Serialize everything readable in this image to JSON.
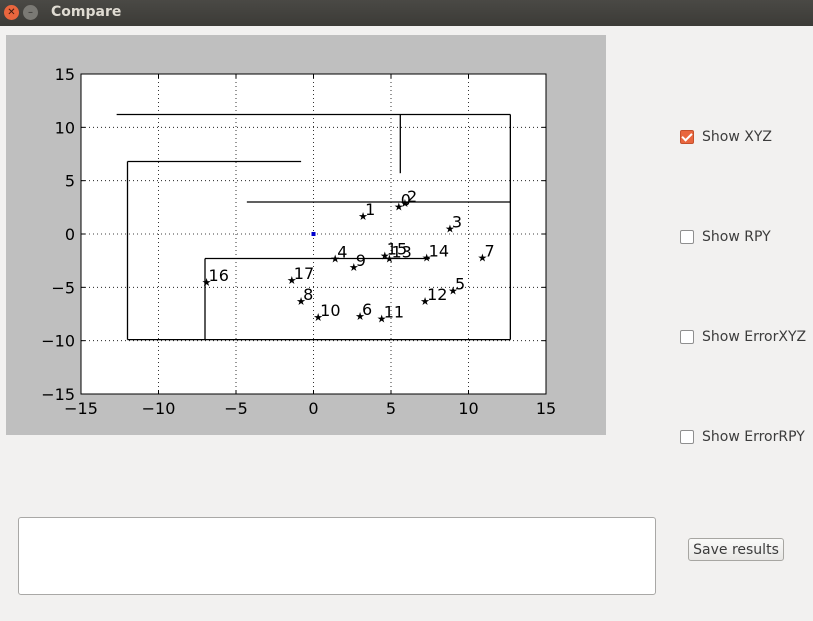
{
  "window": {
    "title": "Compare"
  },
  "options": [
    {
      "label": "Show XYZ",
      "checked": true
    },
    {
      "label": "Show RPY",
      "checked": false
    },
    {
      "label": "Show ErrorXYZ",
      "checked": false
    },
    {
      "label": "Show ErrorRPY",
      "checked": false
    }
  ],
  "results_text": "",
  "save_button": {
    "label": "Save results"
  },
  "chart_data": {
    "type": "scatter",
    "xlim": [
      -15,
      15
    ],
    "ylim": [
      -15,
      15
    ],
    "xticks": [
      -15,
      -10,
      -5,
      0,
      5,
      10,
      15
    ],
    "yticks": [
      -15,
      -10,
      -5,
      0,
      5,
      10,
      15
    ],
    "grid": "dotted",
    "points": [
      {
        "label": "0",
        "x": 5.5,
        "y": 2.6
      },
      {
        "label": "1",
        "x": 3.2,
        "y": 1.7
      },
      {
        "label": "2",
        "x": 5.9,
        "y": 2.9
      },
      {
        "label": "3",
        "x": 8.8,
        "y": 0.5
      },
      {
        "label": "4",
        "x": 1.4,
        "y": -2.3
      },
      {
        "label": "5",
        "x": 9.0,
        "y": -5.3
      },
      {
        "label": "6",
        "x": 3.0,
        "y": -7.7
      },
      {
        "label": "7",
        "x": 10.9,
        "y": -2.2
      },
      {
        "label": "8",
        "x": -0.8,
        "y": -6.3
      },
      {
        "label": "9",
        "x": 2.6,
        "y": -3.1
      },
      {
        "label": "10",
        "x": 0.3,
        "y": -7.8
      },
      {
        "label": "11",
        "x": 4.4,
        "y": -7.9
      },
      {
        "label": "12",
        "x": 7.2,
        "y": -6.3
      },
      {
        "label": "13",
        "x": 4.9,
        "y": -2.3
      },
      {
        "label": "14",
        "x": 7.3,
        "y": -2.2
      },
      {
        "label": "15",
        "x": 4.6,
        "y": -2.0
      },
      {
        "label": "16",
        "x": -6.9,
        "y": -4.5
      },
      {
        "label": "17",
        "x": -1.4,
        "y": -4.3
      }
    ],
    "marker_points": [
      {
        "x": 0,
        "y": 0,
        "color": "#0000cc"
      }
    ],
    "walls": [
      {
        "x": [
          -12.7,
          12.7
        ],
        "y": [
          11.2,
          11.2
        ]
      },
      {
        "x": [
          12.7,
          12.7
        ],
        "y": [
          11.2,
          -9.9
        ]
      },
      {
        "x": [
          -12.0,
          12.7
        ],
        "y": [
          -9.9,
          -9.9
        ]
      },
      {
        "x": [
          -12.0,
          -12.0
        ],
        "y": [
          6.8,
          -9.9
        ]
      },
      {
        "x": [
          -12.0,
          -0.8
        ],
        "y": [
          6.8,
          6.8
        ]
      },
      {
        "x": [
          5.6,
          5.6
        ],
        "y": [
          11.2,
          5.7
        ]
      },
      {
        "x": [
          -4.3,
          12.7
        ],
        "y": [
          3.0,
          3.0
        ]
      },
      {
        "x": [
          -7.0,
          7.5
        ],
        "y": [
          -2.3,
          -2.3
        ]
      },
      {
        "x": [
          -7.0,
          -7.0
        ],
        "y": [
          -2.3,
          -9.9
        ]
      }
    ]
  }
}
